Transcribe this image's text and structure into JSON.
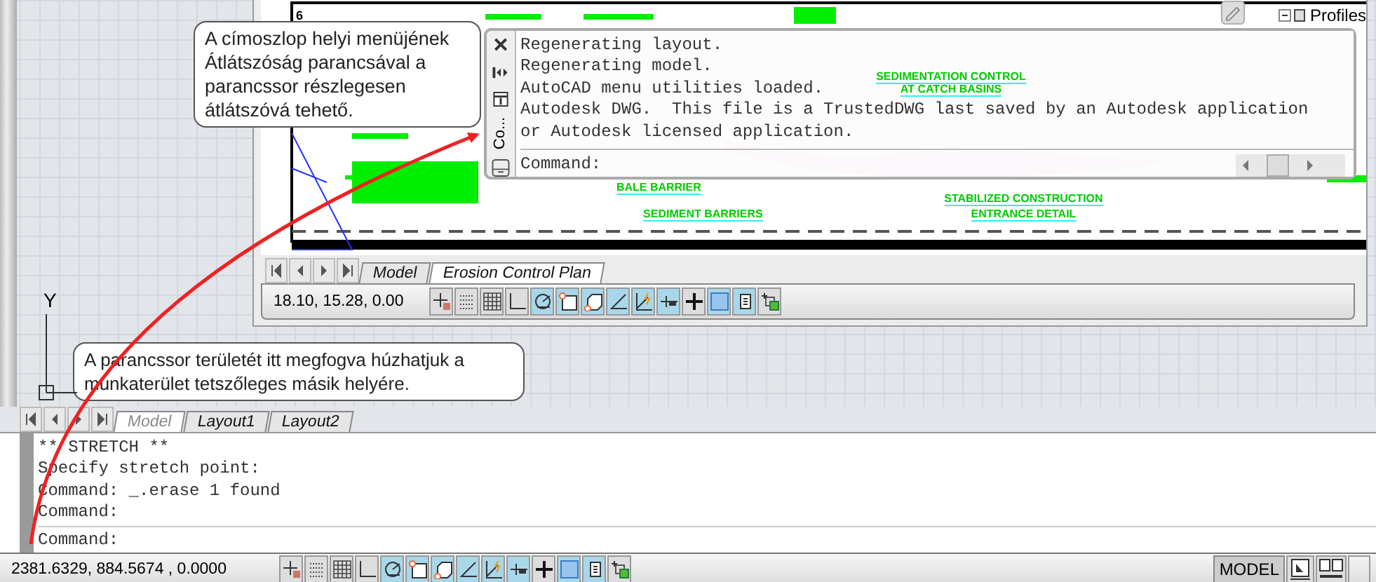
{
  "drawing": {
    "sheet_number": "6",
    "profiles_label": "Profiles",
    "labels": [
      {
        "text": "SEDIMENTATION CONTROL"
      },
      {
        "text": "AT CATCH BASINS"
      },
      {
        "text": "BALE BARRIER"
      },
      {
        "text": "SEDIMENT BARRIERS"
      },
      {
        "text": "STABILIZED CONSTRUCTION"
      },
      {
        "text": "ENTRANCE DETAIL"
      }
    ]
  },
  "inner_tabs": [
    {
      "label": "Model",
      "selected": false
    },
    {
      "label": "Erosion Control Plan",
      "selected": true
    }
  ],
  "inner_status_bar": {
    "coordinates": "18.10, 15.28, 0.00",
    "toggles": [
      {
        "kind": "infer",
        "on": false
      },
      {
        "kind": "snap",
        "on": false
      },
      {
        "kind": "grid",
        "on": false
      },
      {
        "kind": "ortho",
        "on": false
      },
      {
        "kind": "polar",
        "on": true
      },
      {
        "kind": "osnap",
        "on": true
      },
      {
        "kind": "osnap3d",
        "on": true
      },
      {
        "kind": "otrack",
        "on": true
      },
      {
        "kind": "dynamic",
        "on": true
      },
      {
        "kind": "lineweight",
        "on": true
      },
      {
        "kind": "crosshair",
        "on": false
      },
      {
        "kind": "transparency",
        "on": true
      },
      {
        "kind": "quickprops",
        "on": true
      },
      {
        "kind": "selcycle",
        "on": false
      }
    ]
  },
  "command_palette": {
    "title": "Co...",
    "history": [
      "Regenerating layout.",
      "Regenerating model.",
      "AutoCAD menu utilities loaded.",
      "Autodesk DWG.  This file is a TrustedDWG last saved by an Autodesk application",
      "or Autodesk licensed application."
    ],
    "prompt": "Command:"
  },
  "callouts": [
    "A címoszlop helyi menüjének Átlátszóság parancsával a parancssor részlegesen átlátszóvá tehető.",
    "A parancssor területét itt megfogva húzhatjuk a munkaterület tetszőleges másik helyére."
  ],
  "ucs": {
    "y_label": "Y"
  },
  "layout_tabs": [
    {
      "label": "Model",
      "selected": true
    },
    {
      "label": "Layout1",
      "selected": false
    },
    {
      "label": "Layout2",
      "selected": false
    }
  ],
  "command_line": {
    "history": [
      "** STRETCH **",
      "Specify stretch point:",
      "Command: _.erase 1 found",
      "Command:"
    ],
    "prompt": "Command:"
  },
  "status_bar": {
    "coordinates": "2381.6329, 884.5674 , 0.0000",
    "toggles": [
      {
        "kind": "infer",
        "on": false
      },
      {
        "kind": "snap",
        "on": false
      },
      {
        "kind": "grid",
        "on": false
      },
      {
        "kind": "ortho",
        "on": false
      },
      {
        "kind": "polar",
        "on": true
      },
      {
        "kind": "osnap",
        "on": true
      },
      {
        "kind": "osnap3d",
        "on": true
      },
      {
        "kind": "otrack",
        "on": true
      },
      {
        "kind": "dynamic",
        "on": true
      },
      {
        "kind": "lineweight",
        "on": true
      },
      {
        "kind": "crosshair",
        "on": false
      },
      {
        "kind": "transparency",
        "on": true
      },
      {
        "kind": "quickprops",
        "on": true
      },
      {
        "kind": "selcycle",
        "on": false
      }
    ],
    "space": "MODEL"
  }
}
